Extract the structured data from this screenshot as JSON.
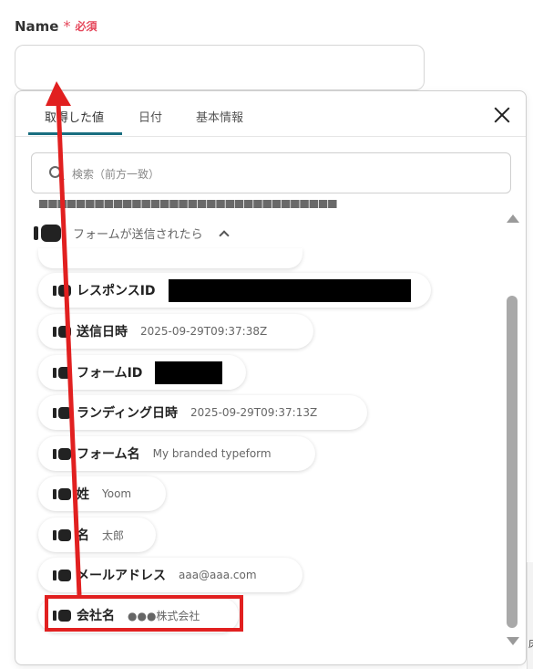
{
  "field": {
    "label": "Name",
    "required_mark": "*",
    "required_text": "必須"
  },
  "tabs": [
    "取得した値",
    "日付",
    "基本情報"
  ],
  "search": {
    "placeholder": "検索（前方一致）"
  },
  "group": {
    "title": "フォームが送信されたら"
  },
  "items": [
    {
      "key": "レスポンスID",
      "value": ""
    },
    {
      "key": "送信日時",
      "value": "2025-09-29T09:37:38Z"
    },
    {
      "key": "フォームID",
      "value": ""
    },
    {
      "key": "ランディング日時",
      "value": "2025-09-29T09:37:13Z"
    },
    {
      "key": "フォーム名",
      "value": "My branded typeform"
    },
    {
      "key": "姓",
      "value": "Yoom"
    },
    {
      "key": "名",
      "value": "太郎"
    },
    {
      "key": "メールアドレス",
      "value": "aaa@aaa.com"
    },
    {
      "key": "会社名",
      "value": "●●●株式会社"
    }
  ],
  "edge_text": "床",
  "colors": {
    "required": "#e5475b",
    "tab_accent": "#1a6e80",
    "highlight": "#e12020"
  }
}
